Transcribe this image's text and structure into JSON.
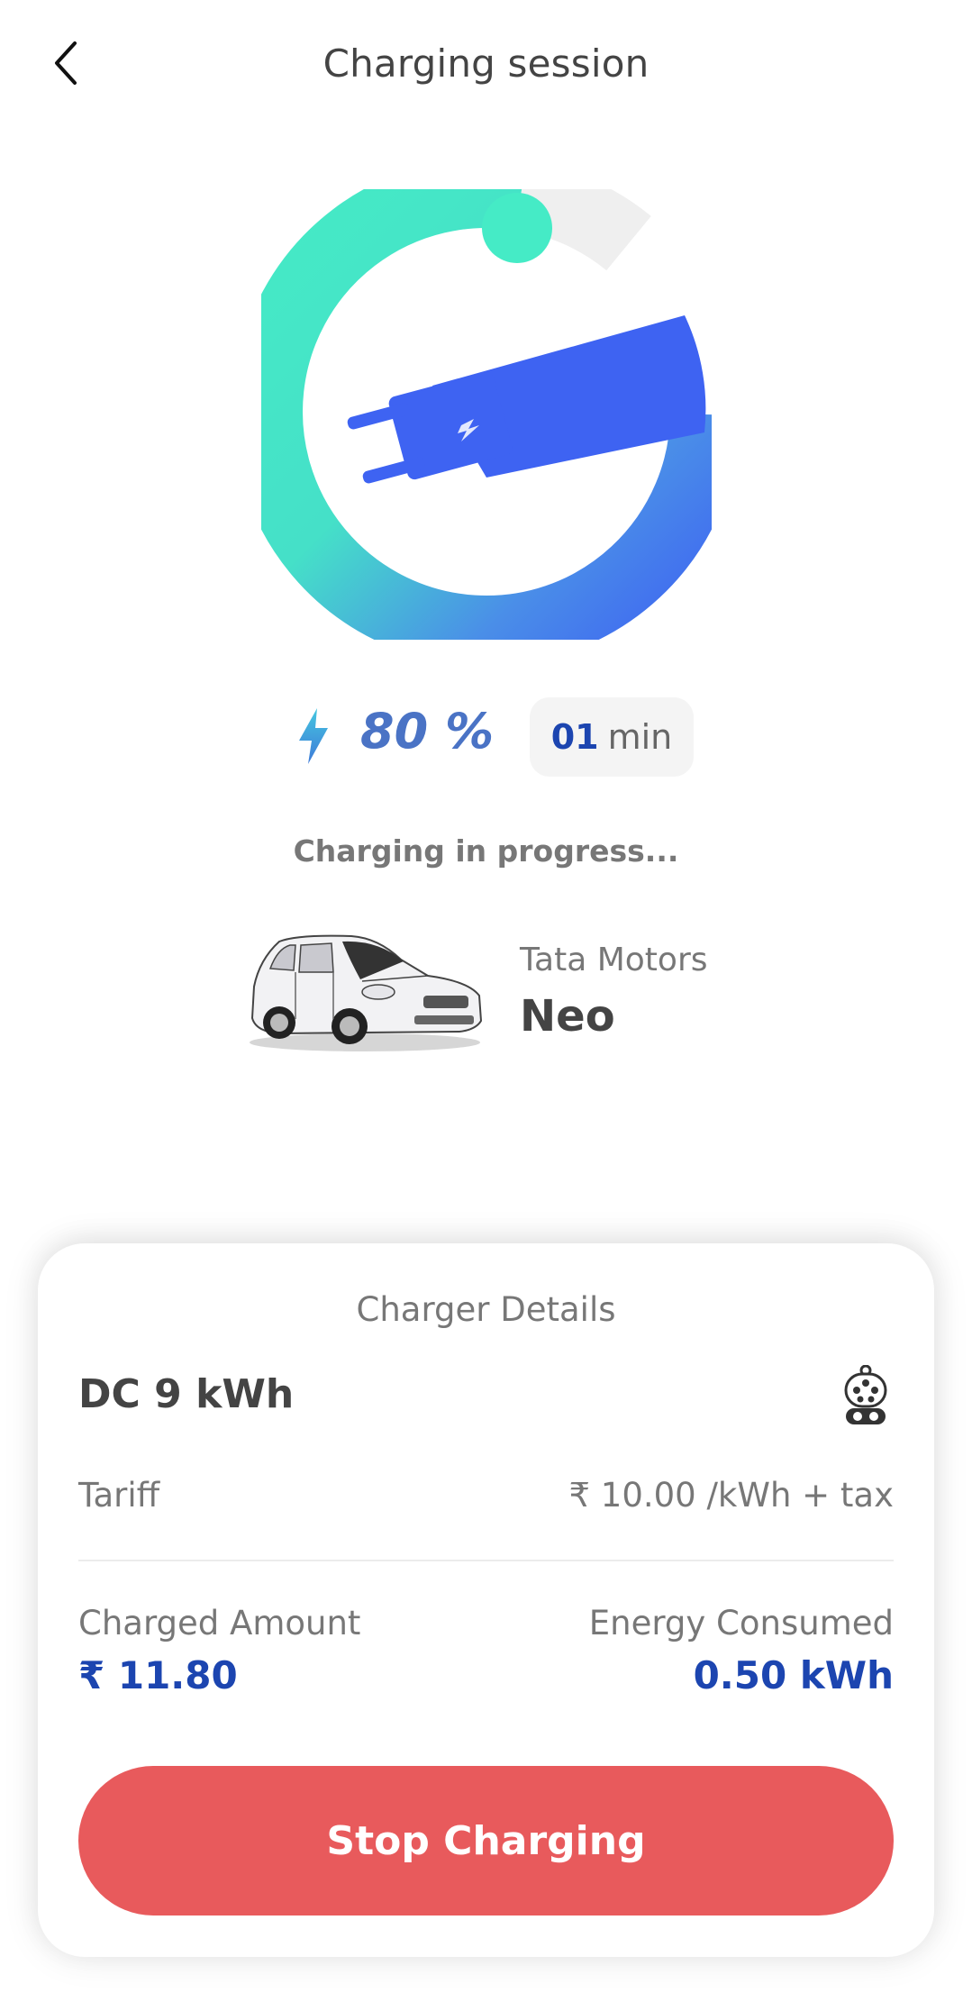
{
  "header": {
    "title": "Charging session",
    "back_icon": "chevron-left-icon"
  },
  "session": {
    "charge_percent_label": "80 %",
    "charge_percent": 80,
    "time_value": "01",
    "time_unit": "min",
    "status": "Charging in progress..."
  },
  "vehicle": {
    "make": "Tata Motors",
    "model": "Neo"
  },
  "charger": {
    "title": "Charger Details",
    "type": "DC 9 kWh",
    "tariff_label": "Tariff",
    "tariff_value": "₹ 10.00 /kWh + tax",
    "charged_label": "Charged Amount",
    "charged_value": "₹ 11.80",
    "energy_label": "Energy Consumed",
    "energy_value": "0.50 kWh"
  },
  "actions": {
    "stop_label": "Stop Charging"
  },
  "colors": {
    "accent_blue": "#1c45b0",
    "percent_blue": "#4a73c5",
    "logo_teal": "#45e8c4",
    "logo_blue": "#3e63f2",
    "stop_red": "#e85a5c"
  }
}
